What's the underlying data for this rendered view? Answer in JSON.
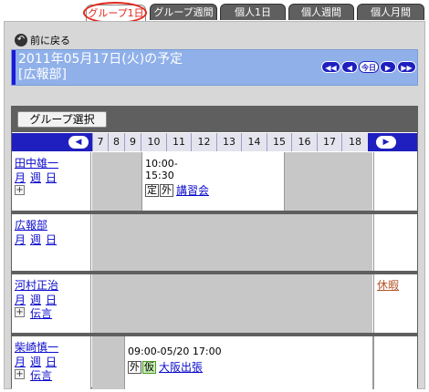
{
  "tabs": [
    {
      "label": "グループ1日",
      "active": true
    },
    {
      "label": "グループ週間",
      "active": false
    },
    {
      "label": "個人1日",
      "active": false
    },
    {
      "label": "個人週間",
      "active": false
    },
    {
      "label": "個人月間",
      "active": false
    }
  ],
  "back_label": "前に戻る",
  "title": {
    "line1": "2011年05月17日(火)の予定",
    "line2": "[広報部]"
  },
  "nav": {
    "prev_week": "◀◀",
    "prev_day": "◀",
    "today": "今日",
    "next_day": "▶",
    "next_week": "▶▶"
  },
  "group_select_label": "グループ選択",
  "hours": [
    "7",
    "8",
    "9",
    "10",
    "11",
    "12",
    "13",
    "14",
    "15",
    "16",
    "17",
    "18"
  ],
  "hour_prev": "◀",
  "hour_next": "▶",
  "link_labels": {
    "month": "月",
    "week": "週",
    "day": "日",
    "memo": "伝言",
    "plus": "+"
  },
  "members": [
    {
      "name": "田中雄一",
      "event": {
        "time_start": "10:00-",
        "time_end": "15:30",
        "badges": [
          "定",
          "外"
        ],
        "title": "講習会"
      }
    },
    {
      "name": "広報部"
    },
    {
      "name": "河村正治",
      "holiday": "休暇"
    },
    {
      "name": "柴崎慎一",
      "event": {
        "time": "09:00-05/20 17:00",
        "badges": [
          "外",
          "仮"
        ],
        "title": "大阪出張"
      }
    }
  ],
  "colors": {
    "tab_bg": "#5f5f5f",
    "highlight": "#e2261b",
    "title_bar": "#8fb0e9",
    "hours_bar": "#1f1fbf",
    "busy": "#c7c7c7",
    "link": "#0a0acd"
  }
}
